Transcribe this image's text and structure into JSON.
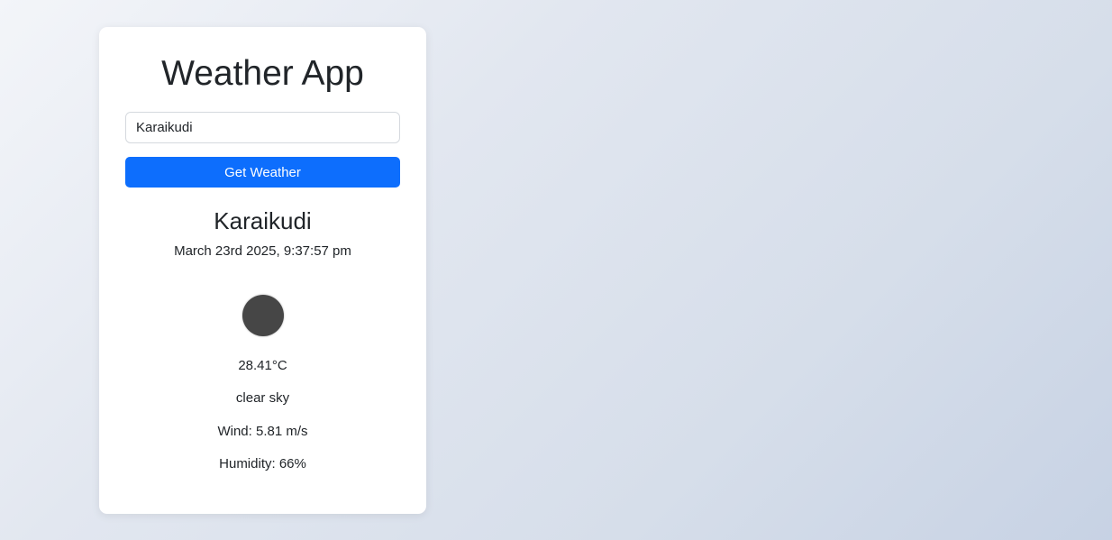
{
  "app": {
    "title": "Weather App"
  },
  "search": {
    "value": "Karaikudi",
    "button_label": "Get Weather"
  },
  "weather": {
    "city": "Karaikudi",
    "datetime": "March 23rd 2025, 9:37:57 pm",
    "icon": "weather-icon",
    "temperature": "28.41°C",
    "description": "clear sky",
    "wind": "Wind: 5.81 m/s",
    "humidity": "Humidity: 66%"
  },
  "colors": {
    "accent": "#0d6efd",
    "icon_fill": "#464646"
  }
}
